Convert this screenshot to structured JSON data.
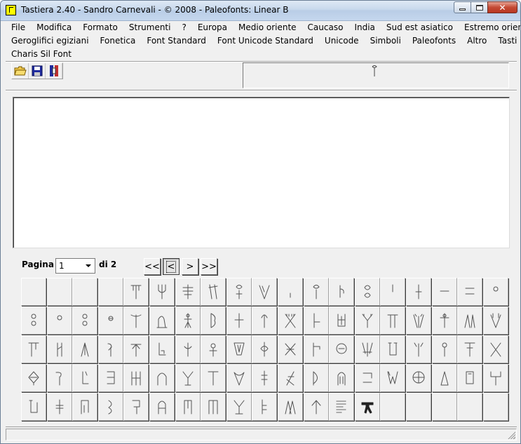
{
  "window": {
    "title": "Tastiera 2.40 - Sandro Carnevali - ©  2008 - Paleofonts: Linear B"
  },
  "menu": {
    "rows": [
      [
        "File",
        "Modifica",
        "Formato",
        "Strumenti",
        "?",
        "Europa",
        "Medio oriente",
        "Caucaso",
        "India",
        "Sud est asiatico",
        "Estremo oriente"
      ],
      [
        "Geroglifici egiziani",
        "Fonetica",
        "Font Standard",
        "Font Unicode Standard",
        "Unicode",
        "Simboli",
        "Paleofonts",
        "Altro",
        "Tasti multipli"
      ],
      [
        "Charis Sil Font"
      ]
    ]
  },
  "toolbar": {
    "buttons": [
      {
        "name": "open-folder-icon"
      },
      {
        "name": "save-disk-icon"
      },
      {
        "name": "tool-icon"
      }
    ]
  },
  "pager": {
    "label": "Pagina",
    "current": "1",
    "of_label": "di",
    "total": "2",
    "first": "<<",
    "prev": "<",
    "next": ">",
    "last": ">>"
  },
  "grid": {
    "columns": 19,
    "cells": [
      "",
      "",
      "",
      "",
      "g1",
      "g2",
      "g3",
      "g4",
      "g5",
      "g6",
      "g7",
      "g8",
      "g9",
      "g10",
      "g11",
      "g12",
      "g13",
      "g14",
      "g15",
      "g16",
      "g17",
      "g18",
      "g19",
      "g20",
      "g21",
      "g22",
      "g23",
      "g24",
      "g25",
      "g26",
      "g27",
      "g28",
      "g29",
      "g30",
      "g31",
      "g32",
      "g33",
      "g34",
      "g35",
      "g36",
      "g37",
      "g38",
      "g39",
      "g40",
      "g41",
      "g42",
      "g43",
      "g44",
      "g45",
      "g46",
      "g47",
      "g48",
      "g49",
      "g50",
      "g51",
      "g52",
      "g53",
      "g54",
      "g55",
      "g56",
      "g57",
      "g58",
      "g59",
      "g60",
      "g61",
      "g62",
      "g63",
      "g64",
      "g65",
      "g66",
      "g67",
      "g68",
      "g69",
      "g70",
      "g71",
      "g72",
      "g73",
      "g74",
      "g75",
      "g76",
      "g77",
      "g78",
      "g79",
      "g80",
      "g81",
      "g82",
      "g83",
      "g84",
      "g85",
      "g86",
      "",
      "",
      "",
      "",
      ""
    ]
  }
}
